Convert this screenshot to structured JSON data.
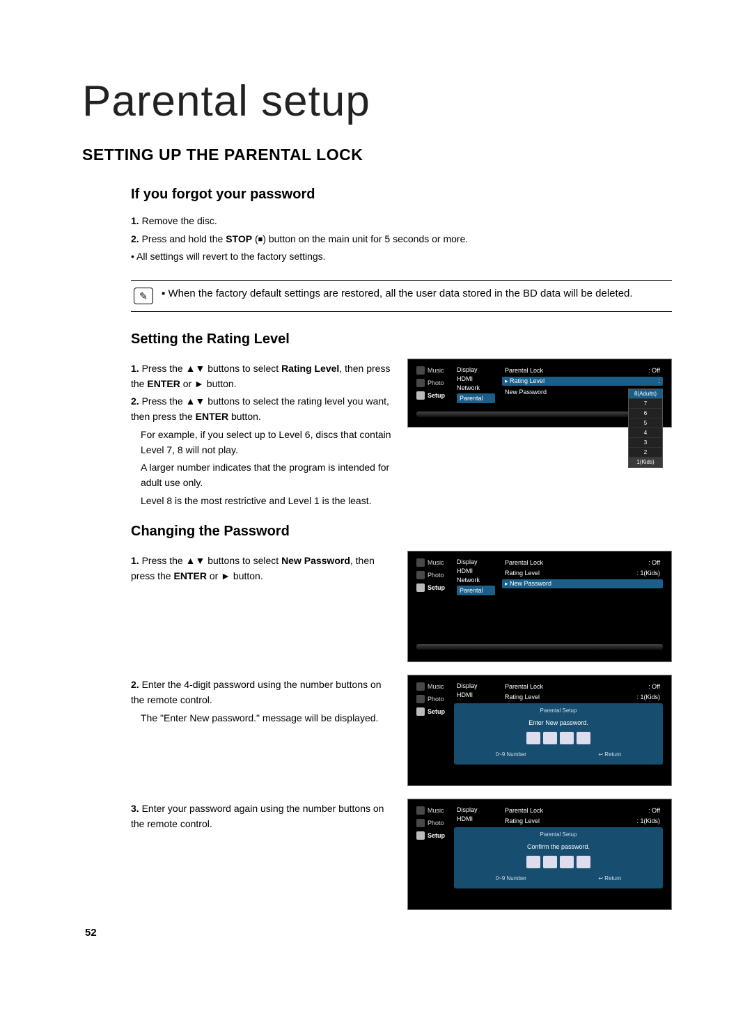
{
  "title": "Parental setup",
  "section_heading": "SETTING UP THE PARENTAL LOCK",
  "forgot": {
    "heading": "If you forgot your password",
    "step1_num": "1.",
    "step1": "Remove the disc.",
    "step2_num": "2.",
    "step2_a": "Press and hold the ",
    "step2_b": "STOP",
    "step2_c": " (",
    "step2_stopglyph": "■",
    "step2_d": ") button on the main unit for 5 seconds or more.",
    "bullet": "• All settings will revert to the factory settings."
  },
  "note": {
    "icon": "✎",
    "sep": "▪",
    "text": "When the factory default settings are restored, all the user data stored in the BD data will be deleted."
  },
  "rating": {
    "heading": "Setting the Rating Level",
    "s1_num": "1.",
    "s1_a": "Press the ▲▼ buttons to select ",
    "s1_b": "Rating Level",
    "s1_c": ", then press the ",
    "s1_d": "ENTER",
    "s1_e": " or ► button.",
    "s2_num": "2.",
    "s2_a": "Press the ▲▼ buttons to select the rating level you want, then press the ",
    "s2_b": "ENTER",
    "s2_c": " button.",
    "s2_d": "For example, if you select up to Level 6, discs that contain Level 7, 8 will not play.",
    "s2_e": "A larger number indicates that the program is intended for adult use only.",
    "s2_f": "Level 8 is the most restrictive and Level 1 is the least."
  },
  "changing": {
    "heading": "Changing the Password",
    "s1_num": "1.",
    "s1_a": "Press the ▲▼ buttons to select ",
    "s1_b": "New Password",
    "s1_c": ", then press the ",
    "s1_d": "ENTER",
    "s1_e": " or ► button.",
    "s2_num": "2.",
    "s2_a": "Enter the 4-digit password using the number buttons on the remote control.",
    "s2_b": "The \"Enter New password.\" message will be displayed.",
    "s3_num": "3.",
    "s3_a": "Enter your password again using the number buttons on the remote control."
  },
  "tv": {
    "side": {
      "music": "Music",
      "photo": "Photo",
      "setup": "Setup"
    },
    "menu": {
      "display": "Display",
      "hdmi": "HDMI",
      "network": "Network",
      "parental": "Parental"
    },
    "detail": {
      "pl_label": "Parental Lock",
      "pl_value": ": Off",
      "rl_label": "Rating Level",
      "rl_value": ":",
      "np_label": "New Password",
      "rl_value_1k": ": 1(Kids)"
    },
    "picklist": [
      "8(Adults)",
      "7",
      "6",
      "5",
      "4",
      "3",
      "2",
      "1(Kids)"
    ],
    "dialog": {
      "title": "Parental Setup",
      "enter_msg": "Enter New password.",
      "confirm_msg": "Confirm the password.",
      "number_hint": "0~9 Number",
      "return_hint": "↩ Return"
    }
  },
  "page_number": "52"
}
